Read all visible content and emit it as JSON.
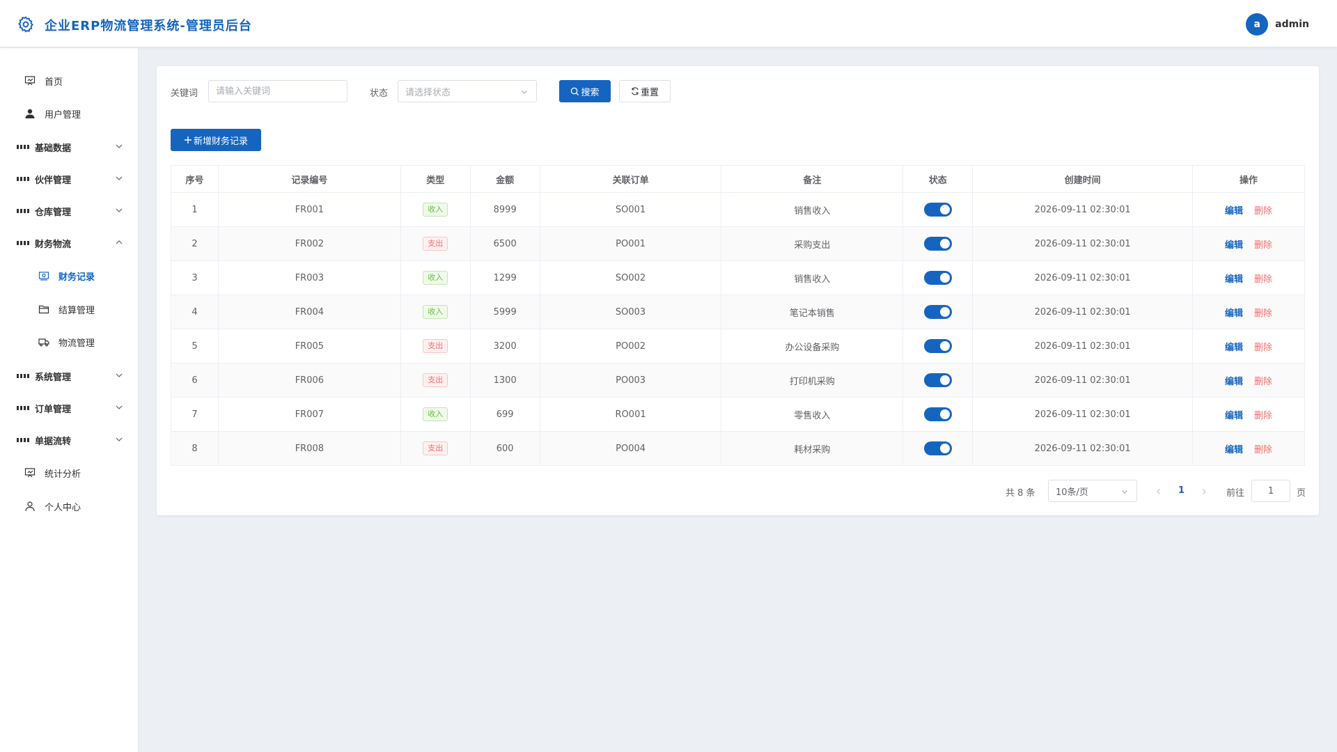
{
  "app": {
    "title": "企业ERP物流管理系统-管理员后台",
    "logo_icon": "gear-icon"
  },
  "user": {
    "avatar_letter": "a",
    "name": "admin"
  },
  "sidebar": {
    "items": [
      {
        "label": "首页",
        "icon": "dashboard-icon"
      },
      {
        "label": "用户管理",
        "icon": "user-icon"
      },
      {
        "label": "基础数据",
        "icon": "grid-icon"
      },
      {
        "label": "伙伴管理",
        "icon": "grid-icon"
      },
      {
        "label": "仓库管理",
        "icon": "grid-icon"
      },
      {
        "label": "财务物流",
        "icon": "grid-icon",
        "expanded": true
      },
      {
        "label": "财务记录",
        "icon": "money-icon",
        "active": true
      },
      {
        "label": "结算管理",
        "icon": "folder-icon"
      },
      {
        "label": "物流管理",
        "icon": "truck-icon"
      },
      {
        "label": "系统管理",
        "icon": "grid-icon"
      },
      {
        "label": "订单管理",
        "icon": "grid-icon"
      },
      {
        "label": "单据流转",
        "icon": "grid-icon"
      },
      {
        "label": "统计分析",
        "icon": "chart-icon"
      },
      {
        "label": "个人中心",
        "icon": "user-outline-icon"
      }
    ]
  },
  "filters": {
    "keyword_label": "关键词",
    "keyword_placeholder": "请输入关键词",
    "keyword_value": "",
    "status_label": "状态",
    "status_placeholder": "请选择状态",
    "search_label": "搜索",
    "reset_label": "重置"
  },
  "toolbar": {
    "add_label": "新增财务记录"
  },
  "table": {
    "columns": [
      "序号",
      "记录编号",
      "类型",
      "金额",
      "关联订单",
      "备注",
      "状态",
      "创建时间",
      "操作"
    ],
    "rows": [
      {
        "index": "1",
        "code": "FR001",
        "type": "收入",
        "amount": "8999",
        "order": "SO001",
        "remark": "销售收入",
        "status": true,
        "created": "2026-09-11 02:30:01"
      },
      {
        "index": "2",
        "code": "FR002",
        "type": "支出",
        "amount": "6500",
        "order": "PO001",
        "remark": "采购支出",
        "status": true,
        "created": "2026-09-11 02:30:01"
      },
      {
        "index": "3",
        "code": "FR003",
        "type": "收入",
        "amount": "1299",
        "order": "SO002",
        "remark": "销售收入",
        "status": true,
        "created": "2026-09-11 02:30:01"
      },
      {
        "index": "4",
        "code": "FR004",
        "type": "收入",
        "amount": "5999",
        "order": "SO003",
        "remark": "笔记本销售",
        "status": true,
        "created": "2026-09-11 02:30:01"
      },
      {
        "index": "5",
        "code": "FR005",
        "type": "支出",
        "amount": "3200",
        "order": "PO002",
        "remark": "办公设备采购",
        "status": true,
        "created": "2026-09-11 02:30:01"
      },
      {
        "index": "6",
        "code": "FR006",
        "type": "支出",
        "amount": "1300",
        "order": "PO003",
        "remark": "打印机采购",
        "status": true,
        "created": "2026-09-11 02:30:01"
      },
      {
        "index": "7",
        "code": "FR007",
        "type": "收入",
        "amount": "699",
        "order": "RO001",
        "remark": "零售收入",
        "status": true,
        "created": "2026-09-11 02:30:01"
      },
      {
        "index": "8",
        "code": "FR008",
        "type": "支出",
        "amount": "600",
        "order": "PO004",
        "remark": "耗材采购",
        "status": true,
        "created": "2026-09-11 02:30:01"
      }
    ],
    "edit_label": "编辑",
    "delete_label": "删除"
  },
  "pagination": {
    "total_text": "共 8 条",
    "page_size": "10条/页",
    "current_page": "1",
    "goto_label": "前往",
    "goto_value": "1",
    "page_suffix": "页"
  },
  "colors": {
    "primary": "#1565c0",
    "income": "#67c23a",
    "expense": "#f56c6c"
  }
}
